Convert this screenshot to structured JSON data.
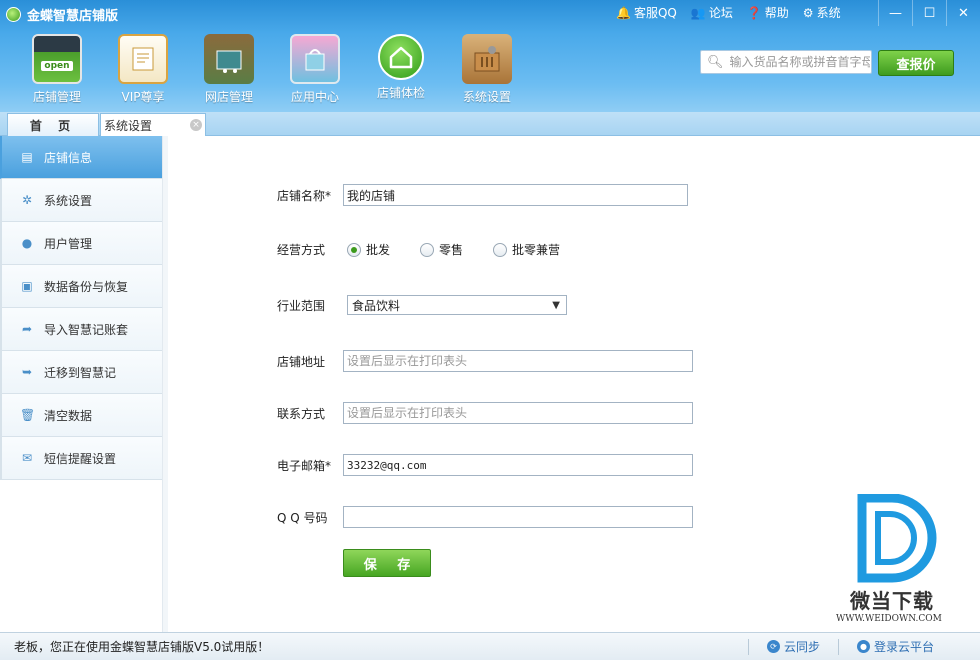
{
  "app": {
    "title": "金蝶智慧店铺版"
  },
  "top_links": [
    {
      "label": "客服QQ",
      "icon": "bell-icon"
    },
    {
      "label": "论坛",
      "icon": "users-icon"
    },
    {
      "label": "帮助",
      "icon": "help-icon"
    },
    {
      "label": "系统",
      "icon": "gear-icon"
    }
  ],
  "window": {
    "minimize": "—",
    "maximize": "☐",
    "close": "✕"
  },
  "nav": [
    {
      "label": "店铺管理"
    },
    {
      "label": "VIP尊享"
    },
    {
      "label": "网店管理"
    },
    {
      "label": "应用中心"
    },
    {
      "label": "店铺体检"
    },
    {
      "label": "系统设置"
    }
  ],
  "nav_store_icon_text": "open",
  "search": {
    "placeholder": "输入货品名称或拼音首字母"
  },
  "price_button": "查报价",
  "tabs": {
    "home": "首 页",
    "settings": "系统设置",
    "close": "×"
  },
  "sidebar": [
    {
      "label": "店铺信息",
      "active": true
    },
    {
      "label": "系统设置"
    },
    {
      "label": "用户管理"
    },
    {
      "label": "数据备份与恢复"
    },
    {
      "label": "导入智慧记账套"
    },
    {
      "label": "迁移到智慧记"
    },
    {
      "label": "清空数据"
    },
    {
      "label": "短信提醒设置"
    }
  ],
  "form": {
    "shop_name": {
      "label": "店铺名称*",
      "value": "我的店铺"
    },
    "biz_mode": {
      "label": "经营方式",
      "options": [
        "批发",
        "零售",
        "批零兼营"
      ],
      "selected": "批发"
    },
    "industry": {
      "label": "行业范围",
      "value": "食品饮料"
    },
    "address": {
      "label": "店铺地址",
      "value": "",
      "placeholder": "设置后显示在打印表头"
    },
    "contact": {
      "label": "联系方式",
      "value": "",
      "placeholder": "设置后显示在打印表头"
    },
    "email": {
      "label": "电子邮箱*",
      "value": "33232@qq.com"
    },
    "qq": {
      "label": "Q Q 号码",
      "value": ""
    },
    "save": "保 存"
  },
  "watermark": {
    "name": "微当下载",
    "url": "WWW.WEIDOWN.COM"
  },
  "status": {
    "message": "老板，您正在使用金蝶智慧店铺版V5.0试用版！",
    "sync": "云同步",
    "login": "登录云平台"
  },
  "colors": {
    "accent": "#4aa0de",
    "header": "#49a9ea",
    "green": "#47a623"
  }
}
